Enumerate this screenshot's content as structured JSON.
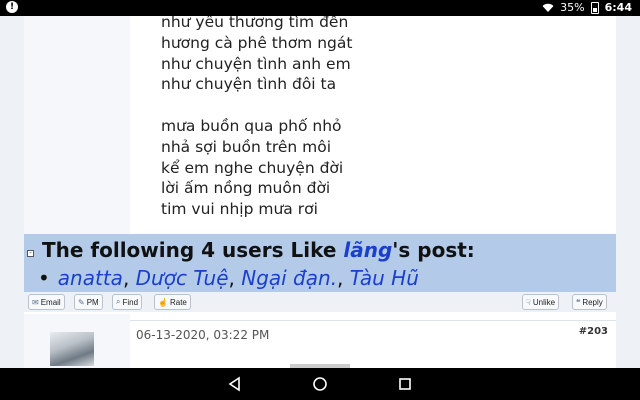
{
  "status_bar": {
    "battery": "35%",
    "time": "6:44"
  },
  "poem": {
    "stanza1": [
      "như yêu thương tìm đến",
      "hương cà phê thơm ngát",
      "như chuyện tình anh em",
      "như chuyện tình đôi ta"
    ],
    "stanza2": [
      "mưa buồn qua phố nhỏ",
      "nhả sợi buồn trên môi",
      "kể em nghe chuyện đời",
      "lời ấm nồng muôn đời",
      "tim vui nhịp mưa rơi"
    ]
  },
  "likes": {
    "prefix": "The following 4 users Like ",
    "author": "lãng",
    "suffix": "'s post:",
    "users": [
      "anatta",
      "Dược Tuệ",
      "Ngại đạn.",
      "Tàu Hũ"
    ]
  },
  "buttons": {
    "email": "Email",
    "pm": "PM",
    "find": "Find",
    "rate": "Rate",
    "unlike": "Unlike",
    "reply": "Reply"
  },
  "next_post": {
    "date": "06-13-2020, 03:22 PM",
    "number": "#203"
  }
}
